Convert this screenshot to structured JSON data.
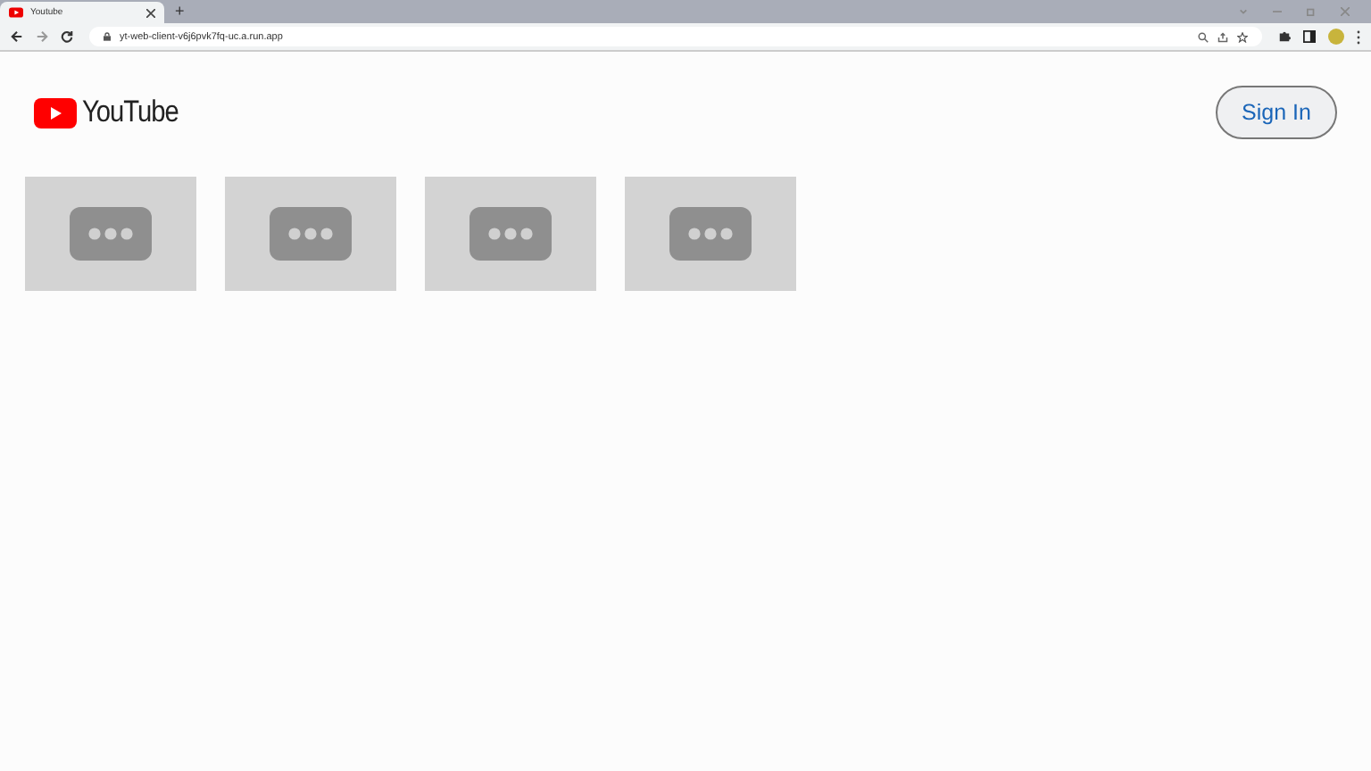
{
  "browser": {
    "tabs": [
      {
        "title": "Youtube",
        "selected": true
      }
    ],
    "new_tab": "+",
    "address": "yt-web-client-v6j6pvk7fq-uc.a.run.app"
  },
  "page": {
    "logo_text": "YouTube",
    "sign_in": "Sign In",
    "videos": [
      {
        "kind": "placeholder"
      },
      {
        "kind": "placeholder"
      },
      {
        "kind": "placeholder"
      },
      {
        "kind": "placeholder"
      }
    ]
  }
}
